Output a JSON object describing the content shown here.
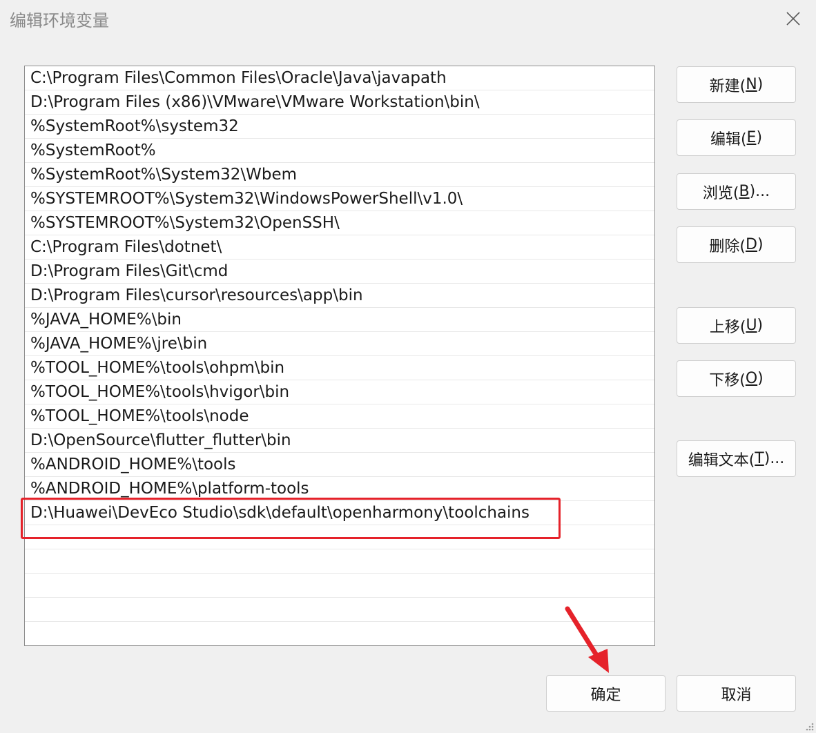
{
  "window": {
    "title": "编辑环境变量"
  },
  "paths": [
    "C:\\Program Files\\Common Files\\Oracle\\Java\\javapath",
    "D:\\Program Files (x86)\\VMware\\VMware Workstation\\bin\\",
    "%SystemRoot%\\system32",
    "%SystemRoot%",
    "%SystemRoot%\\System32\\Wbem",
    "%SYSTEMROOT%\\System32\\WindowsPowerShell\\v1.0\\",
    "%SYSTEMROOT%\\System32\\OpenSSH\\",
    "C:\\Program Files\\dotnet\\",
    "D:\\Program Files\\Git\\cmd",
    "D:\\Program Files\\cursor\\resources\\app\\bin",
    "%JAVA_HOME%\\bin",
    "%JAVA_HOME%\\jre\\bin",
    "%TOOL_HOME%\\tools\\ohpm\\bin",
    "%TOOL_HOME%\\tools\\hvigor\\bin",
    "%TOOL_HOME%\\tools\\node",
    "D:\\OpenSource\\flutter_flutter\\bin",
    "%ANDROID_HOME%\\tools",
    "%ANDROID_HOME%\\platform-tools",
    "D:\\Huawei\\DevEco Studio\\sdk\\default\\openharmony\\toolchains",
    "",
    "",
    "",
    "",
    ""
  ],
  "buttons": {
    "new": {
      "label": "新建(",
      "key": "N",
      "suffix": ")"
    },
    "edit": {
      "label": "编辑(",
      "key": "E",
      "suffix": ")"
    },
    "browse": {
      "label": "浏览(",
      "key": "B",
      "suffix": ")..."
    },
    "delete": {
      "label": "删除(",
      "key": "D",
      "suffix": ")"
    },
    "move_up": {
      "label": "上移(",
      "key": "U",
      "suffix": ")"
    },
    "move_down": {
      "label": "下移(",
      "key": "O",
      "suffix": ")"
    },
    "edit_text": {
      "label": "编辑文本(",
      "key": "T",
      "suffix": ")..."
    },
    "ok": "确定",
    "cancel": "取消"
  },
  "colors": {
    "highlight": "#e5222a"
  },
  "icons": {
    "close": "close-icon",
    "arrow": "red-arrow-annotation",
    "grip": "resize-grip-icon"
  }
}
